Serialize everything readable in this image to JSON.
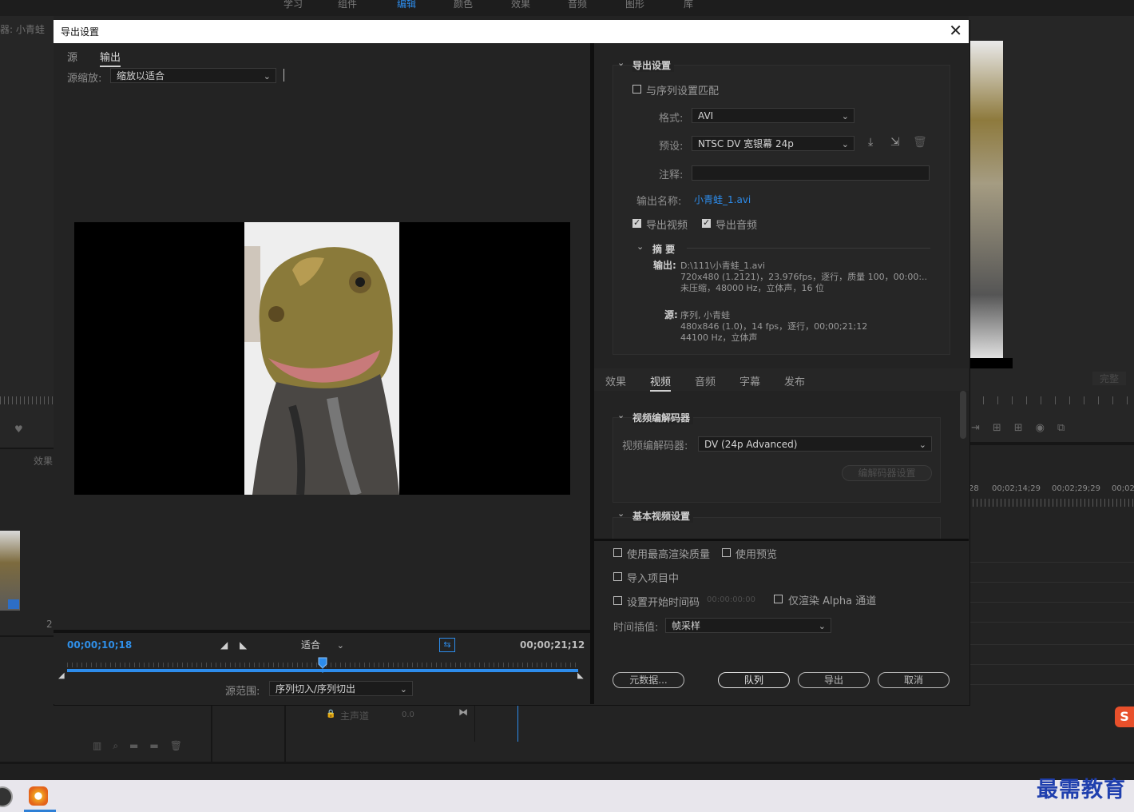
{
  "background_app": {
    "top_tabs": [
      "学习",
      "组件",
      "编辑",
      "颜色",
      "效果",
      "音频",
      "图形",
      "库"
    ],
    "active_tab_index": 2,
    "panel_label_left": "器: 小青蛙",
    "panel_label_effects": "效果",
    "right_label_complete": "完整",
    "timeline_timecodes": [
      "28",
      "00;02;14;29",
      "00;02;29;29",
      "00;02"
    ],
    "master_track_label": "主声道",
    "master_track_value": "0.0",
    "left_small_number": "2:",
    "watermark_text": "最需教育"
  },
  "dialog": {
    "title": "导出设置",
    "close_icon": "close-icon",
    "left": {
      "tabs": [
        {
          "label": "源",
          "active": false
        },
        {
          "label": "输出",
          "active": true
        }
      ],
      "source_scale_label": "源缩放:",
      "source_scale_value": "缩放以适合",
      "current_timecode": "00;00;10;18",
      "end_timecode": "00;00;21;12",
      "fit_value": "适合",
      "source_range_label": "源范围:",
      "source_range_value": "序列切入/序列切出",
      "playhead_fraction": 0.5
    },
    "export_settings": {
      "heading": "导出设置",
      "match_sequence_label": "与序列设置匹配",
      "match_sequence_checked": false,
      "format_label": "格式:",
      "format_value": "AVI",
      "preset_label": "预设:",
      "preset_value": "NTSC DV 宽银幕 24p",
      "comment_label": "注释:",
      "comment_value": "",
      "output_name_label": "输出名称:",
      "output_name_value": "小青蛙_1.avi",
      "export_video_label": "导出视频",
      "export_video_checked": true,
      "export_audio_label": "导出音频",
      "export_audio_checked": true,
      "summary_heading": "摘 要",
      "output_key": "输出:",
      "output_line1": "D:\\111\\小青蛙_1.avi",
      "output_line2": "720x480 (1.2121)，23.976fps，逐行，质量 100，00:00:...",
      "output_line3": "未压缩，48000 Hz，立体声，16 位",
      "source_key": "源:",
      "source_line1": "序列, 小青蛙",
      "source_line2": "480x846 (1.0)，14 fps，逐行，00;00;21;12",
      "source_line3": "44100 Hz，立体声"
    },
    "right_tabs": [
      {
        "label": "效果",
        "active": false
      },
      {
        "label": "视频",
        "active": true
      },
      {
        "label": "音频",
        "active": false
      },
      {
        "label": "字幕",
        "active": false
      },
      {
        "label": "发布",
        "active": false
      }
    ],
    "video_codec": {
      "heading": "视频编解码器",
      "codec_label": "视频编解码器:",
      "codec_value": "DV (24p Advanced)",
      "codec_settings_button": "编解码器设置"
    },
    "basic_video": {
      "heading": "基本视频设置"
    },
    "bottom": {
      "max_render_quality_label": "使用最高渲染质量",
      "use_previews_label": "使用预览",
      "import_into_project_label": "导入项目中",
      "set_start_timecode_label": "设置开始时间码",
      "start_timecode_value": "00:00:00:00",
      "render_alpha_only_label": "仅渲染 Alpha 通道",
      "time_interp_label": "时间插值:",
      "time_interp_value": "帧采样",
      "metadata_button": "元数据...",
      "queue_button": "队列",
      "export_button": "导出",
      "cancel_button": "取消"
    }
  }
}
